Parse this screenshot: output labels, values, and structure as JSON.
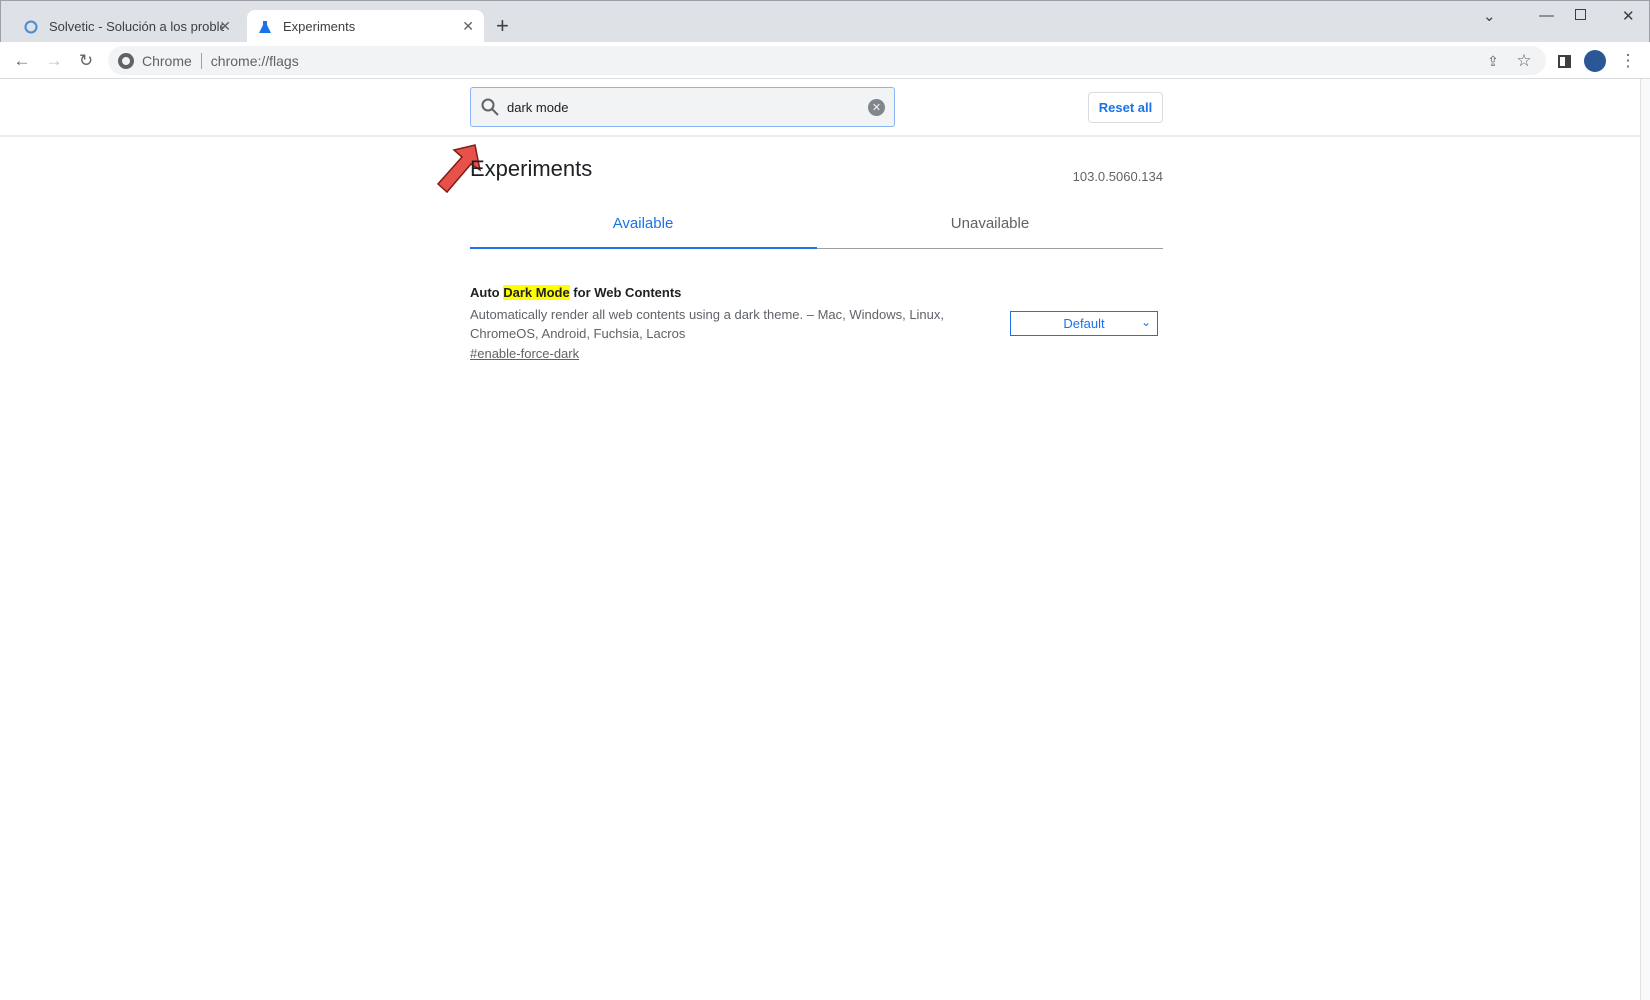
{
  "tabs": [
    {
      "title": "Solvetic - Solución a los problem"
    },
    {
      "title": "Experiments"
    }
  ],
  "toolbar": {
    "site_label": "Chrome",
    "url": "chrome://flags"
  },
  "search": {
    "value": "dark mode"
  },
  "reset_label": "Reset all",
  "page": {
    "title": "Experiments",
    "version": "103.0.5060.134"
  },
  "flag_tabs": {
    "available": "Available",
    "unavailable": "Unavailable"
  },
  "flag": {
    "title_pre": "Auto ",
    "title_highlight": "Dark Mode",
    "title_post": " for Web Contents",
    "description": "Automatically render all web contents using a dark theme. – Mac, Windows, Linux, ChromeOS, Android, Fuchsia, Lacros",
    "link": "#enable-force-dark",
    "selected": "Default"
  },
  "colors": {
    "accent": "#1a73e8",
    "highlight": "#ffff00",
    "arrow": "#e8504a"
  }
}
